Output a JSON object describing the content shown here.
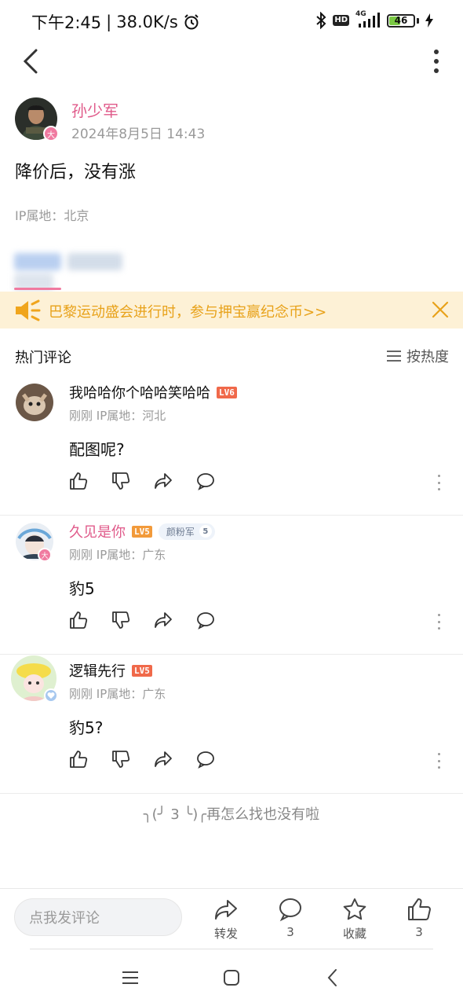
{
  "status_bar": {
    "time": "下午2:45",
    "separator": "|",
    "network_speed": "38.0K/s",
    "network_type": "4G",
    "hd_label": "HD",
    "battery_level": "46",
    "battery_fraction": 0.46
  },
  "post": {
    "author_name": "孙少军",
    "time": "2024年8月5日 14:43",
    "text": "降价后，没有涨",
    "ip_location": "IP属地：北京",
    "verified_mark": "大"
  },
  "banner": {
    "text": "巴黎运动盛会进行时，参与押宝赢纪念币>>",
    "accent_color": "#e8a21a",
    "background_color": "#fdf1d6"
  },
  "comments_section": {
    "title": "热门评论",
    "sort_label": "按热度"
  },
  "comments": [
    {
      "name": "我哈哈你个哈哈笑哈哈",
      "level": "LV6",
      "level_color": "#f0694a",
      "meta": "刚刚  IP属地：河北",
      "text": "配图呢?"
    },
    {
      "name": "久见是你",
      "level": "LV5",
      "level_color": "#f29a3a",
      "fan_badge": "颜粉军",
      "fan_level": "5",
      "badge_mark": "大",
      "meta": "刚刚  IP属地：广东",
      "text": "豹5"
    },
    {
      "name": "逻辑先行",
      "level": "LV5",
      "level_color": "#f0694a",
      "meta": "刚刚  IP属地：广东",
      "text": "豹5?"
    }
  ],
  "end_message": "╮(╯ 3 ╰)╭再怎么找也没有啦",
  "bottom_bar": {
    "input_placeholder": "点我发评论",
    "repost_label": "转发",
    "comment_count": "3",
    "favorite_label": "收藏",
    "like_count": "3"
  },
  "colors": {
    "brand_pink": "#e05a8a",
    "muted_gray": "#9a9a9a"
  }
}
